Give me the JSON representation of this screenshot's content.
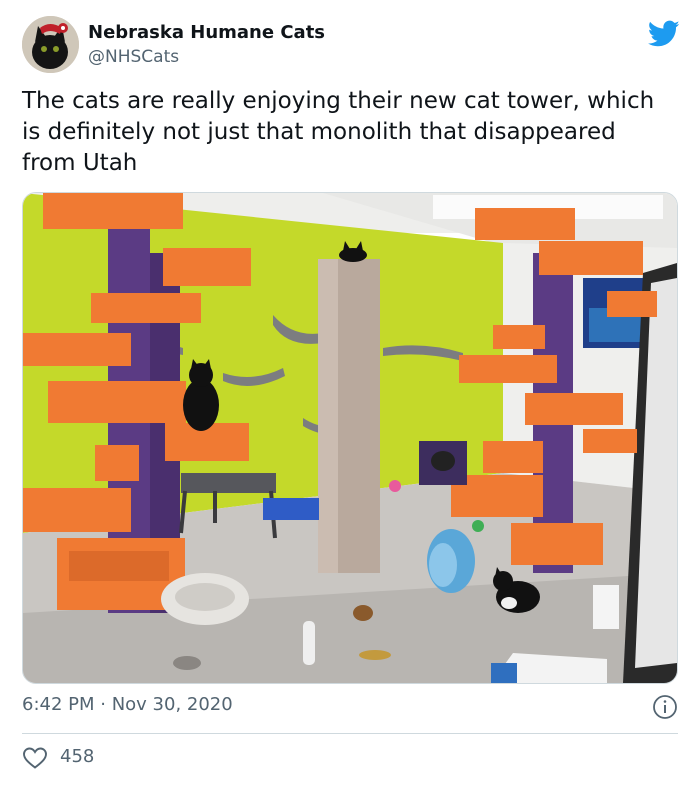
{
  "tweet": {
    "author": {
      "display_name": "Nebraska Humane Cats",
      "handle": "@NHSCats",
      "avatar": "black-cat-avatar"
    },
    "brand_icon": "twitter-bird-icon",
    "brand_color": "#1d9bf0",
    "text": "The cats are really enjoying their new cat tower, which is definitely not just that monolith that disappeared from Utah",
    "image": {
      "description_icon": "cat-room-photo",
      "dominant_colors": [
        "#c4d92a",
        "#f07a33",
        "#5b3b84",
        "#b9a99d"
      ]
    },
    "timestamp": "6:42 PM · Nov 30, 2020",
    "info_icon": "info-icon",
    "likes": {
      "icon": "heart-icon",
      "count": "458"
    }
  },
  "colors": {
    "text_primary": "#0f1419",
    "text_secondary": "#536471",
    "border": "#cfd9de"
  }
}
